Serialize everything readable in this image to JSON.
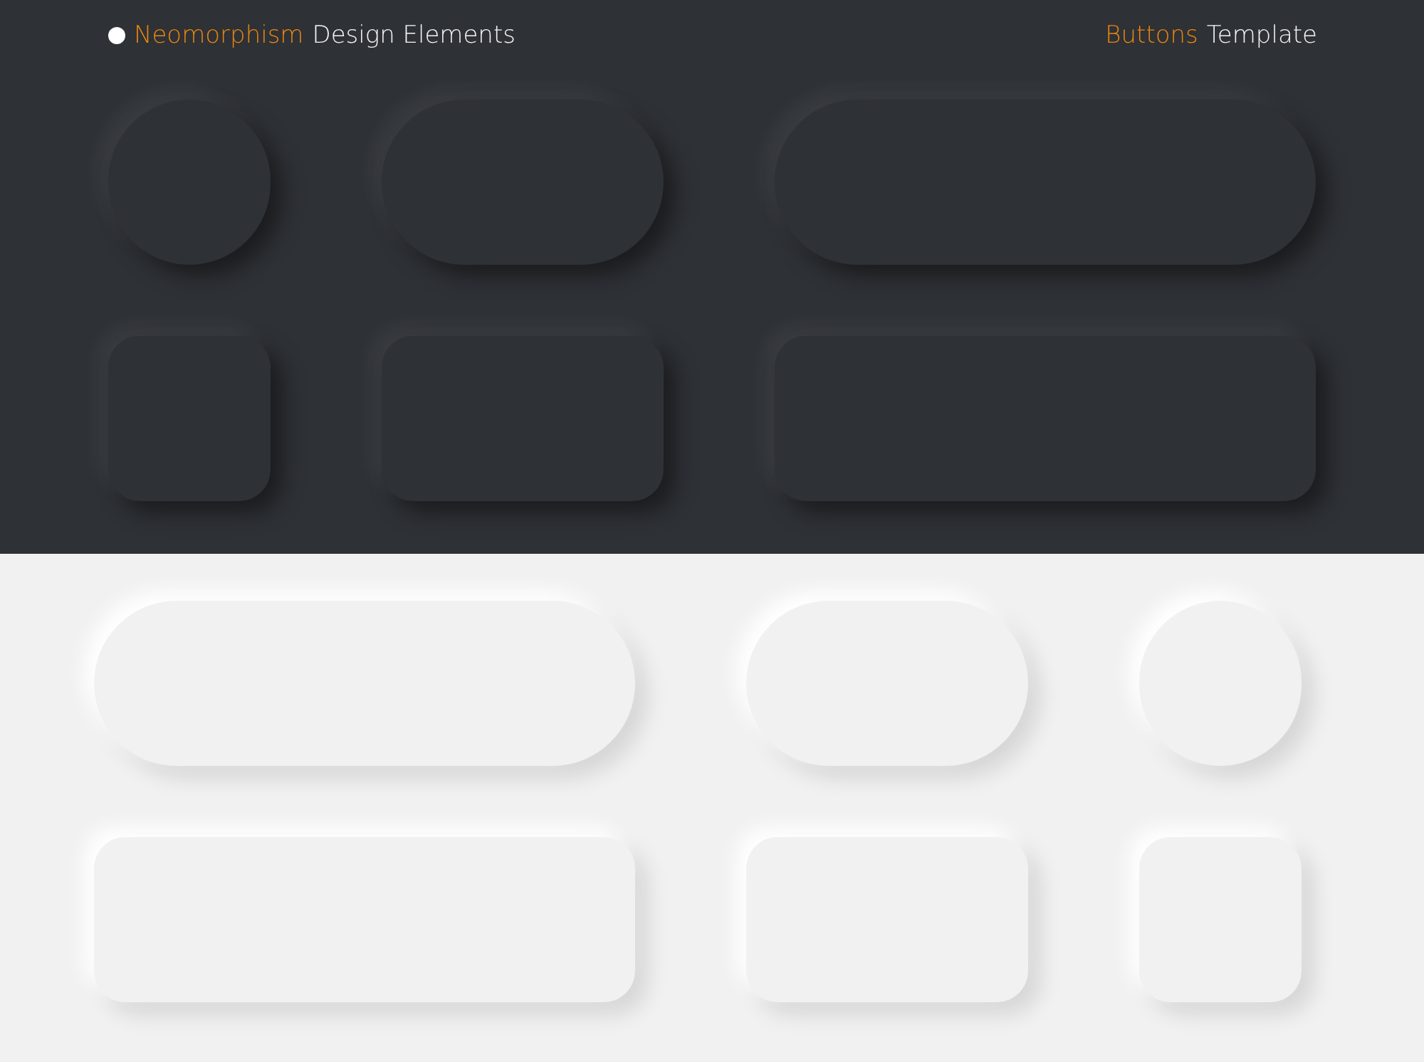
{
  "header": {
    "title_accent": "Neomorphism",
    "title_rest": "Design Elements",
    "subtitle_accent": "Buttons",
    "subtitle_rest": "Template"
  },
  "panels": [
    {
      "kind": "dark",
      "rows": [
        [
          {
            "kind": "circle"
          },
          {
            "kind": "pill"
          },
          {
            "kind": "wide-pill"
          }
        ],
        [
          {
            "kind": "square"
          },
          {
            "kind": "rect"
          },
          {
            "kind": "wide-rect"
          }
        ]
      ]
    },
    {
      "kind": "light",
      "rows": [
        [
          {
            "kind": "wide-pill"
          },
          {
            "kind": "pill"
          },
          {
            "kind": "circle"
          }
        ],
        [
          {
            "kind": "wide-rect"
          },
          {
            "kind": "rect"
          },
          {
            "kind": "square"
          }
        ]
      ]
    }
  ]
}
